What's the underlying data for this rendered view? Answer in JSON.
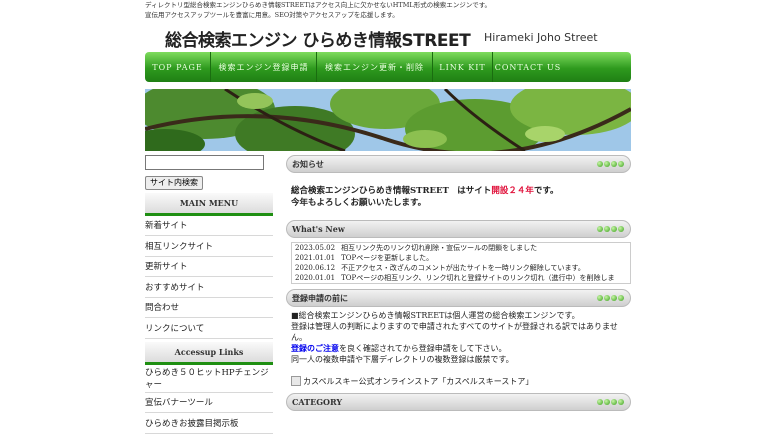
{
  "header": {
    "description_line1": "ディレクトリ型総合検索エンジンひらめき情報STREETはアクセス向上に欠かせないHTML形式の検索エンジンです。",
    "description_line2": "宣伝用アクセスアップツールを豊富に用意。SEO対策やアクセスアップを応援します。",
    "logo_main": "総合検索エンジン ひらめき情報STREET",
    "logo_sub": "Hirameki Joho Street"
  },
  "nav": {
    "items": [
      "TOP PAGE",
      "検索エンジン登録申請",
      "検索エンジン更新・削除",
      "LINK KIT",
      "CONTACT US"
    ]
  },
  "sidebar": {
    "search_button": "サイト内検索",
    "main_menu_title": "MAIN MENU",
    "main_menu": [
      "新着サイト",
      "相互リンクサイト",
      "更新サイト",
      "おすすめサイト",
      "問合わせ",
      "リンクについて"
    ],
    "accessup_title": "Accessup Links",
    "accessup_links": [
      "ひらめき５０ヒットHPチェンジャー",
      "宣伝バナーツール",
      "ひらめきお披露目掲示板"
    ]
  },
  "notice": {
    "title": "お知らせ",
    "line1_prefix": "総合検索エンジンひらめき情報STREET　はサイト",
    "line1_highlight": "開設２４年",
    "line1_suffix": "です。",
    "line2": "今年もよろしくお願いいたします。"
  },
  "whats_new": {
    "title": "What's New",
    "items": [
      {
        "date": "2023.05.02",
        "text": "相互リンク先のリンク切れ削除・宣伝ツールの閉鎖をしました"
      },
      {
        "date": "2021.01.01",
        "text": "TOPページを更新しました。"
      },
      {
        "date": "2020.06.12",
        "text": "不正アクセス・改ざんのコメントが出たサイトを一時リンク解除しています。"
      },
      {
        "date": "2020.01.01",
        "text": "TOPページの相互リンク、リンク切れと登録サイトのリンク切れ（進行中）を削除しま"
      }
    ]
  },
  "registration": {
    "title": "登録申請の前に",
    "line1": "■総合検索エンジンひらめき情報STREETは個人運営の総合検索エンジンです。",
    "line2": "登録は管理人の判断によりますので申請されたすべてのサイトが登録される訳ではありませ",
    "line3": "ん。",
    "link": "登録のご注意",
    "line4_suffix": "を良く確認されてから登録申請をして下さい。",
    "line5": "同一人の複数申請や下層ディレクトリの複数登録は厳禁です。",
    "store_alt": "カスペルスキー公式オンラインストア「カスペルスキーストア」"
  },
  "category": {
    "title": "CATEGORY"
  },
  "colors": {
    "nav_green": "#2e9a1e",
    "accent_red": "#e0103a",
    "link_blue": "#0000ee"
  }
}
